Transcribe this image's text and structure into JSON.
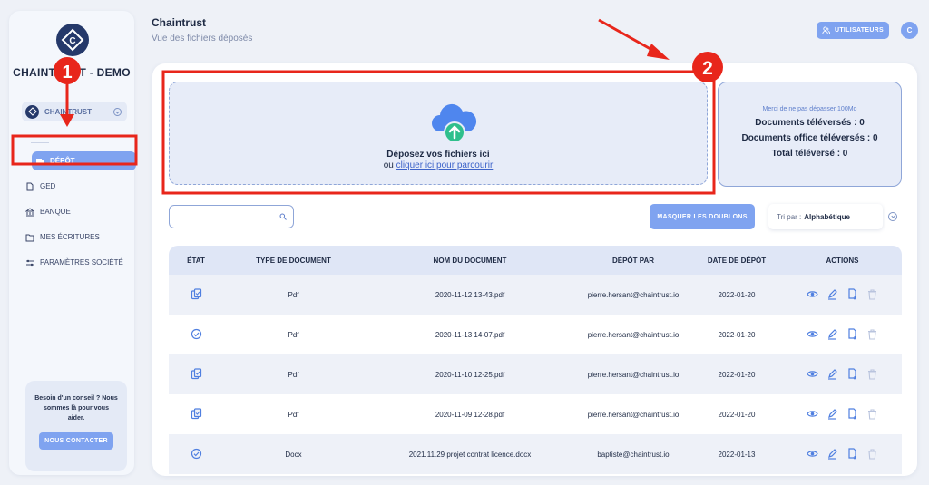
{
  "sidebar": {
    "company_name": "CHAINTRUST - DEMO",
    "company_select": "CHAINTRUST",
    "nav": [
      {
        "label": "DÉPÔT",
        "icon": "upload-icon",
        "active": true
      },
      {
        "label": "GED",
        "icon": "document-icon",
        "active": false
      },
      {
        "label": "BANQUE",
        "icon": "bank-icon",
        "active": false
      },
      {
        "label": "MES ÉCRITURES",
        "icon": "ledger-icon",
        "active": false
      },
      {
        "label": "PARAMÈTRES SOCIÉTÉ",
        "icon": "settings-icon",
        "active": false
      }
    ],
    "help": {
      "text": "Besoin d'un conseil ? Nous sommes là pour vous aider.",
      "button": "NOUS CONTACTER"
    }
  },
  "header": {
    "title": "Chaintrust",
    "subtitle": "Vue des fichiers déposés",
    "users_button": "UTILISATEURS",
    "avatar_initial": "C"
  },
  "upload": {
    "title": "Déposez vos fichiers ici",
    "subtitle_prefix": "ou",
    "subtitle_link": "cliquer ici pour parcourir"
  },
  "stats": {
    "note": "Merci de ne pas dépasser 100Mo",
    "documents": "Documents téléversés : 0",
    "office_documents": "Documents office téléversés : 0",
    "total": "Total téléversé : 0"
  },
  "toolbar": {
    "search_placeholder": "",
    "dedupe_button": "MASQUER LES DOUBLONS",
    "sort_label": "Tri par :",
    "sort_value": "Alphabétique"
  },
  "table": {
    "headers": {
      "etat": "ÉTAT",
      "type": "TYPE DE DOCUMENT",
      "nom": "NOM DU DOCUMENT",
      "depot": "DÉPÔT PAR",
      "date": "DATE DE DÉPÔT",
      "actions": "ACTIONS"
    },
    "rows": [
      {
        "state": "duplicate-icon",
        "type": "Pdf",
        "name": "2020-11-12 13-43.pdf",
        "by": "pierre.hersant@chaintrust.io",
        "date": "2022-01-20"
      },
      {
        "state": "check-circle-icon",
        "type": "Pdf",
        "name": "2020-11-13 14-07.pdf",
        "by": "pierre.hersant@chaintrust.io",
        "date": "2022-01-20"
      },
      {
        "state": "duplicate-icon",
        "type": "Pdf",
        "name": "2020-11-10 12-25.pdf",
        "by": "pierre.hersant@chaintrust.io",
        "date": "2022-01-20"
      },
      {
        "state": "duplicate-icon",
        "type": "Pdf",
        "name": "2020-11-09 12-28.pdf",
        "by": "pierre.hersant@chaintrust.io",
        "date": "2022-01-20"
      },
      {
        "state": "check-circle-icon",
        "type": "Docx",
        "name": "2021.11.29 projet contrat licence.docx",
        "by": "baptiste@chaintrust.io",
        "date": "2022-01-13"
      }
    ]
  },
  "annotations": {
    "marker_1": "1",
    "marker_2": "2"
  },
  "colors": {
    "accent": "#7fa3f0",
    "annotation_red": "#e8261b",
    "dark": "#1e2a44"
  }
}
